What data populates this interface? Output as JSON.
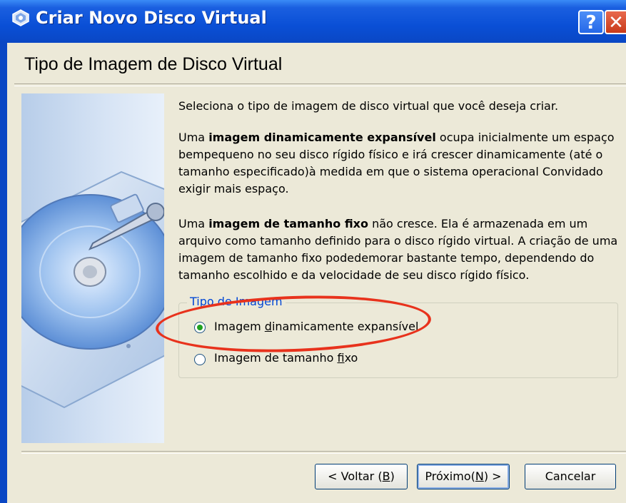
{
  "window": {
    "title": "Criar Novo Disco Virtual",
    "help_button": "?",
    "close_button": "✕"
  },
  "wizard": {
    "heading": "Tipo de Imagem de Disco Virtual",
    "intro": "Seleciona o tipo de imagem de disco virtual que você deseja criar.",
    "dynamic_para": {
      "pre": "Uma ",
      "bold": "imagem dinamicamente expansível",
      "post": " ocupa inicialmente um espaço bempequeno no seu disco rígido físico e irá crescer dinamicamente (até o tamanho especificado)à medida em que o sistema operacional Convidado exigir mais espaço."
    },
    "fixed_para": {
      "pre": "Uma ",
      "bold": "imagem de tamanho fixo",
      "post": " não cresce. Ela é armazenada em um arquivo como tamanho definido para o disco rígido virtual. A criação de uma imagem de tamanho fixo podedemorar bastante tempo, dependendo do tamanho escolhido e da velocidade de seu disco rígido físico."
    },
    "group_title": "Tipo de Imagem",
    "options": [
      {
        "pre": "Imagem ",
        "mnemonic": "d",
        "post": "inamicamente expansível",
        "selected": true
      },
      {
        "pre": "Imagem de tamanho ",
        "mnemonic": "f",
        "post": "ixo",
        "selected": false
      }
    ]
  },
  "buttons": {
    "back": {
      "pre": "< Voltar (",
      "mnemonic": "B",
      "post": ")"
    },
    "next": {
      "pre": "Próximo(",
      "mnemonic": "N",
      "post": ") >"
    },
    "cancel": "Cancelar"
  },
  "colors": {
    "titlebar": "#0a4fd6",
    "dialog_bg": "#ece9d8",
    "group_title": "#0046d5",
    "annotation": "#e8321c"
  }
}
